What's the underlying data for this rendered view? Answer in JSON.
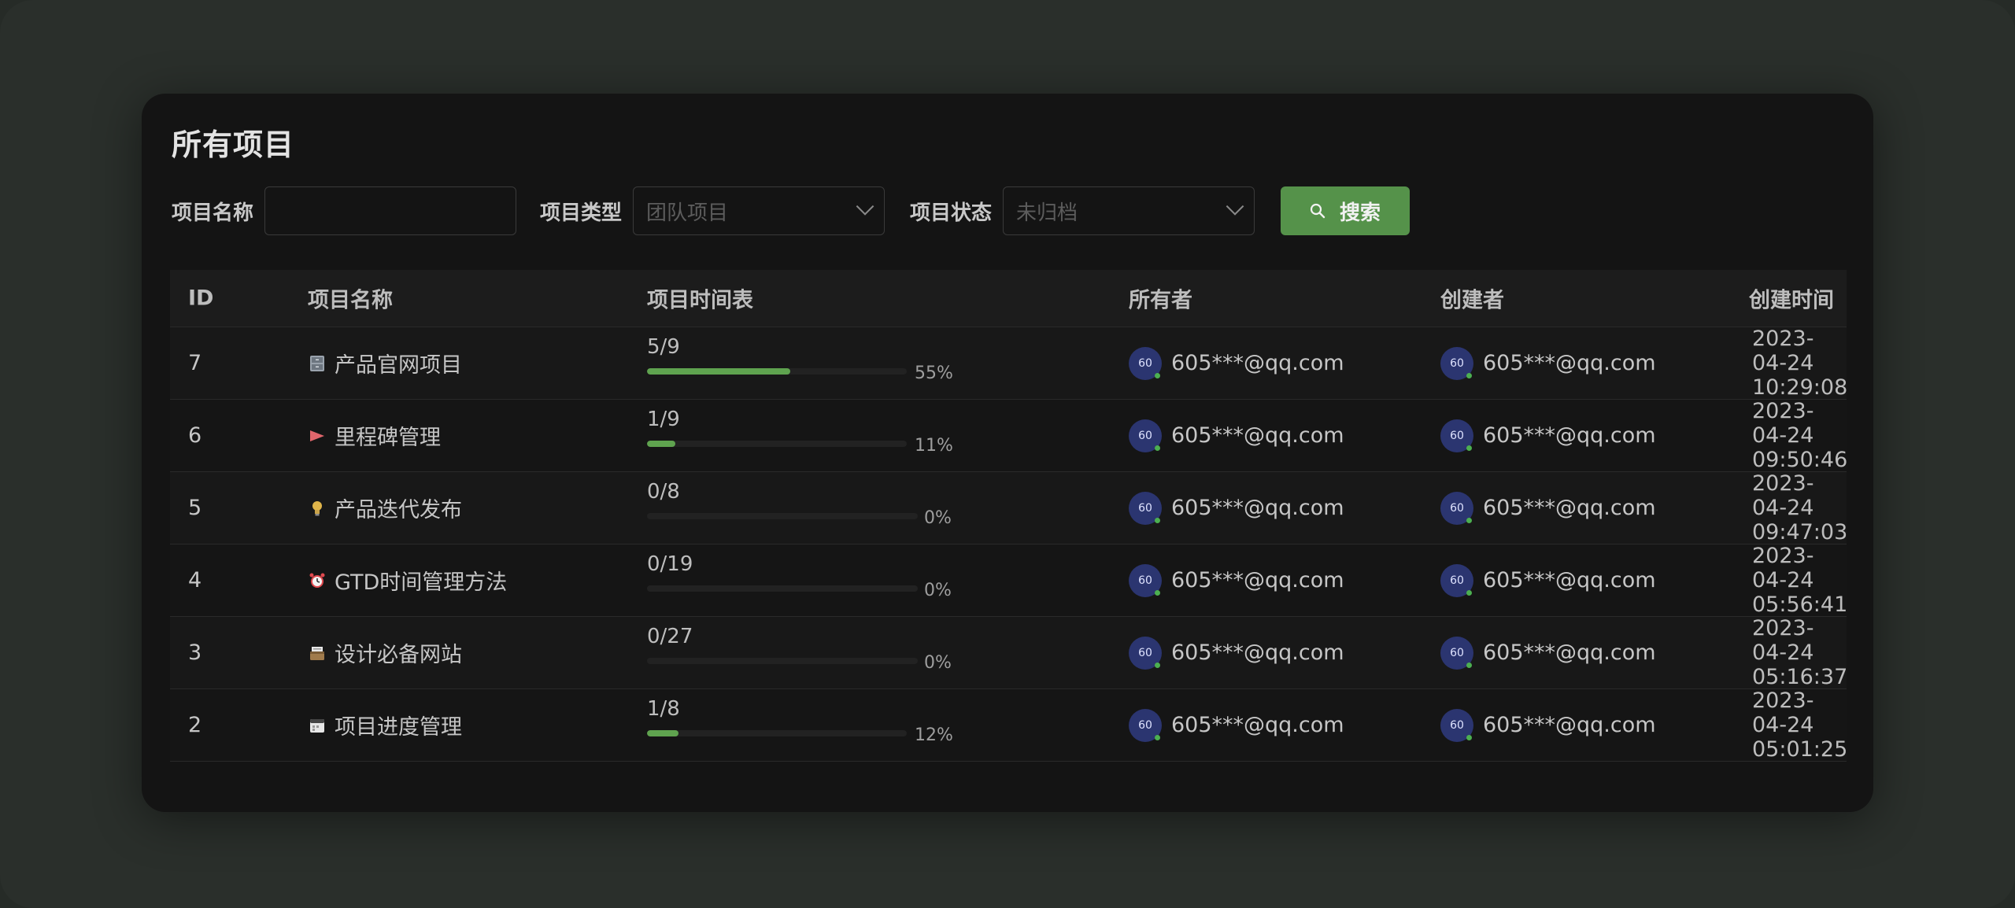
{
  "page": {
    "title": "所有项目"
  },
  "filters": {
    "name_label": "项目名称",
    "name_value": "",
    "type_label": "项目类型",
    "type_placeholder": "团队项目",
    "status_label": "项目状态",
    "status_placeholder": "未归档",
    "search_label": "搜索"
  },
  "table": {
    "columns": [
      "ID",
      "项目名称",
      "项目时间表",
      "所有者",
      "创建者",
      "创建时间"
    ],
    "rows": [
      {
        "id": "7",
        "icon": "file-cabinet-icon",
        "name": "产品官网项目",
        "progress_text": "5/9",
        "progress_pct": "55%",
        "progress": 0.55,
        "owner_avatar": "60",
        "owner": "605***@qq.com",
        "creator_avatar": "60",
        "creator": "605***@qq.com",
        "created": "2023-04-24 10:29:08"
      },
      {
        "id": "6",
        "icon": "red-flag-icon",
        "name": "里程碑管理",
        "progress_text": "1/9",
        "progress_pct": "11%",
        "progress": 0.11,
        "owner_avatar": "60",
        "owner": "605***@qq.com",
        "creator_avatar": "60",
        "creator": "605***@qq.com",
        "created": "2023-04-24 09:50:46"
      },
      {
        "id": "5",
        "icon": "lightbulb-icon",
        "name": "产品迭代发布",
        "progress_text": "0/8",
        "progress_pct": "0%",
        "progress": 0.0,
        "owner_avatar": "60",
        "owner": "605***@qq.com",
        "creator_avatar": "60",
        "creator": "605***@qq.com",
        "created": "2023-04-24 09:47:03"
      },
      {
        "id": "4",
        "icon": "alarm-clock-icon",
        "name": "GTD时间管理方法",
        "progress_text": "0/19",
        "progress_pct": "0%",
        "progress": 0.0,
        "owner_avatar": "60",
        "owner": "605***@qq.com",
        "creator_avatar": "60",
        "creator": "605***@qq.com",
        "created": "2023-04-24 05:56:41"
      },
      {
        "id": "3",
        "icon": "card-box-icon",
        "name": "设计必备网站",
        "progress_text": "0/27",
        "progress_pct": "0%",
        "progress": 0.0,
        "owner_avatar": "60",
        "owner": "605***@qq.com",
        "creator_avatar": "60",
        "creator": "605***@qq.com",
        "created": "2023-04-24 05:16:37"
      },
      {
        "id": "2",
        "icon": "calendar-icon",
        "name": "项目进度管理",
        "progress_text": "1/8",
        "progress_pct": "12%",
        "progress": 0.12,
        "owner_avatar": "60",
        "owner": "605***@qq.com",
        "creator_avatar": "60",
        "creator": "605***@qq.com",
        "created": "2023-04-24 05:01:25"
      }
    ]
  },
  "colors": {
    "background": "#2a2f2b",
    "card": "#141414",
    "accent": "#55924a",
    "progress": "#5fa34f",
    "avatar": "#2b3570"
  }
}
